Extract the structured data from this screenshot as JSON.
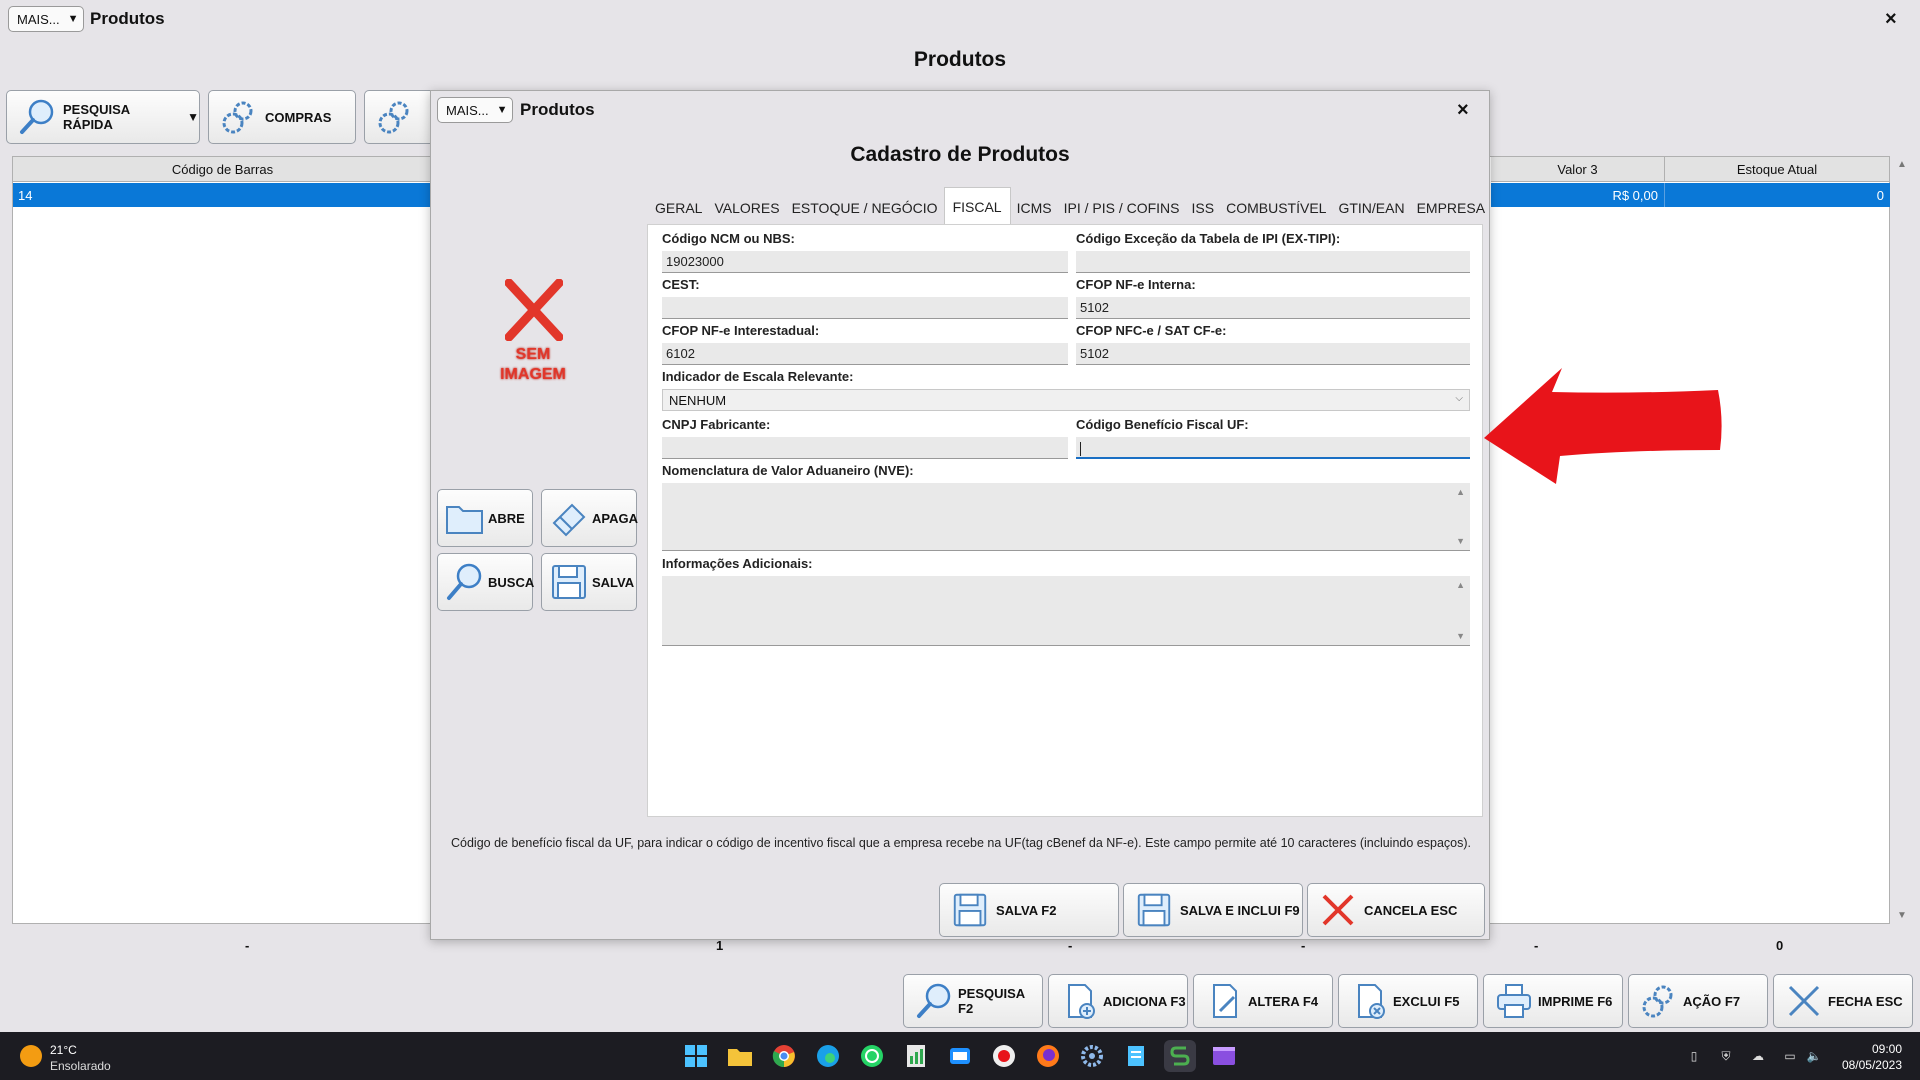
{
  "main_window": {
    "mais_label": "MAIS...",
    "title": "Produtos",
    "close": "×",
    "heading": "Produtos",
    "toolbar": {
      "pesquisa_rapida": "PESQUISA RÁPIDA",
      "compras": "COMPRAS"
    },
    "grid": {
      "col_codigo_barras": "Código de Barras",
      "col_valor3": "Valor 3",
      "col_estoque_atual": "Estoque Atual",
      "row": {
        "codigo_barras": "14",
        "valor3": "R$ 0,00",
        "estoque_atual": "0"
      }
    },
    "totals": {
      "t1": "-",
      "t2": "1",
      "t3": "-",
      "t4": "-",
      "t5": "-",
      "t6": "0"
    },
    "bottom_buttons": {
      "pesquisa": "PESQUISA F2",
      "adiciona": "ADICIONA F3",
      "altera": "ALTERA F4",
      "exclui": "EXCLUI F5",
      "imprime": "IMPRIME F6",
      "acao": "AÇÃO F7",
      "fecha": "FECHA ESC"
    }
  },
  "dialog": {
    "mais_label": "MAIS...",
    "title": "Produtos",
    "close": "×",
    "heading": "Cadastro de Produtos",
    "image_placeholder": [
      "SEM",
      "IMAGEM"
    ],
    "side_buttons": {
      "abre": "ABRE",
      "apaga": "APAGA",
      "busca": "BUSCA",
      "salva": "SALVA"
    },
    "tabs": [
      "GERAL",
      "VALORES",
      "ESTOQUE / NEGÓCIO",
      "FISCAL",
      "ICMS",
      "IPI / PIS / COFINS",
      "ISS",
      "COMBUSTÍVEL",
      "GTIN/EAN",
      "EMPRESA"
    ],
    "active_tab": "FISCAL",
    "fiscal": {
      "ncm_label": "Código NCM ou NBS:",
      "ncm_value": "19023000",
      "ex_tipi_label": "Código Exceção da Tabela de IPI (EX-TIPI):",
      "ex_tipi_value": "",
      "cest_label": "CEST:",
      "cest_value": "",
      "cfop_interna_label": "CFOP NF-e Interna:",
      "cfop_interna_value": "5102",
      "cfop_interestadual_label": "CFOP NF-e Interestadual:",
      "cfop_interestadual_value": "6102",
      "cfop_nfce_label": "CFOP NFC-e / SAT CF-e:",
      "cfop_nfce_value": "5102",
      "escala_label": "Indicador de Escala Relevante:",
      "escala_value": "NENHUM",
      "cnpj_label": "CNPJ Fabricante:",
      "cnpj_value": "",
      "beneficio_label": "Código Benefício Fiscal UF:",
      "beneficio_value": "",
      "nve_label": "Nomenclatura de Valor Aduaneiro (NVE):",
      "info_label": "Informações Adicionais:"
    },
    "hint": "Código de benefício fiscal da UF, para indicar o código de incentivo fiscal que a empresa recebe na UF(tag cBenef da NF-e). Este campo permite até 10 caracteres (incluindo espaços).",
    "buttons": {
      "salva": "SALVA F2",
      "salva_inclui": "SALVA E INCLUI F9",
      "cancela": "CANCELA ESC"
    }
  },
  "taskbar": {
    "temperature": "21°C",
    "weather": "Ensolarado",
    "time": "09:00",
    "date": "08/05/2023"
  },
  "colors": {
    "selection": "#0a78d7",
    "annotation_arrow": "#e8141a",
    "no_image_red": "#e2362a"
  }
}
